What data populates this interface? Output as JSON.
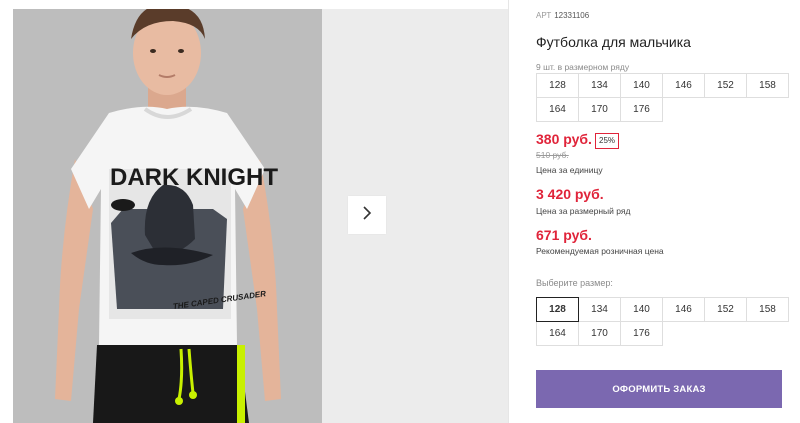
{
  "product": {
    "sku_label": "АРТ",
    "sku_number": "12331106",
    "title": "Футболка для мальчика",
    "set_note": "9 шт. в размерном ряду",
    "size_set": [
      "128",
      "134",
      "140",
      "146",
      "152",
      "158",
      "164",
      "170",
      "176"
    ]
  },
  "gallery": {
    "shirt_print_title": "DARK KNIGHT",
    "shirt_print_subtitle": "THE CAPED CRUSADER"
  },
  "pricing": {
    "unit_price": "380 руб.",
    "discount_badge": "25%",
    "old_price": "510 руб.",
    "unit_caption": "Цена за единицу",
    "set_price": "3 420 руб.",
    "set_caption": "Цена за размерный ряд",
    "retail_price": "671 руб.",
    "retail_caption": "Рекомендуемая розничная цена"
  },
  "size_picker": {
    "label": "Выберите размер:",
    "options": [
      "128",
      "134",
      "140",
      "146",
      "152",
      "158",
      "164",
      "170",
      "176"
    ],
    "selected": "128"
  },
  "order_button": {
    "label": "ОФОРМИТЬ ЗАКАЗ"
  },
  "colors": {
    "price_red": "#e0243a",
    "button_purple": "#7b68b0",
    "neon_accent": "#c8f000"
  },
  "icons": {
    "next": "chevron-right-icon"
  }
}
